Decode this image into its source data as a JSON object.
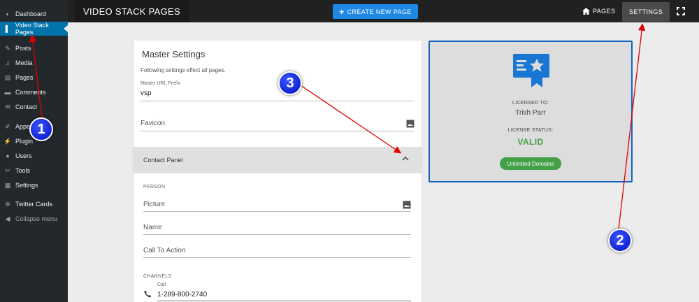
{
  "wp_sidebar": {
    "items": [
      {
        "label": "Dashboard",
        "icon": "dashboard-icon"
      },
      {
        "label": "Video Stack Pages",
        "icon": "pin-icon",
        "active": true
      },
      {
        "label": "Posts",
        "icon": "pin-icon"
      },
      {
        "label": "Media",
        "icon": "media-icon"
      },
      {
        "label": "Pages",
        "icon": "pages-icon"
      },
      {
        "label": "Comments",
        "icon": "comment-icon"
      },
      {
        "label": "Contact",
        "icon": "mail-icon"
      },
      {
        "label": "Appe",
        "icon": "brush-icon"
      },
      {
        "label": "Plugin",
        "icon": "plugin-icon"
      },
      {
        "label": "Users",
        "icon": "user-icon"
      },
      {
        "label": "Tools",
        "icon": "wrench-icon"
      },
      {
        "label": "Settings",
        "icon": "settings-icon"
      },
      {
        "label": "Twitter Cards",
        "icon": "gear-icon"
      },
      {
        "label": "Collapse menu",
        "icon": "collapse-icon"
      }
    ]
  },
  "topbar": {
    "title": "VIDEO STACK PAGES",
    "create_label": "CREATE NEW PAGE",
    "pages_label": "PAGES",
    "settings_label": "SETTINGS"
  },
  "master": {
    "title": "Master Settings",
    "subtitle": "Following settings effect all pages.",
    "url_prefix_label": "Master URL Prefix",
    "url_prefix_value": "vsp",
    "favicon_placeholder": "Favicon"
  },
  "contact": {
    "panel_title": "Contact Panel",
    "person_label": "PERSON",
    "picture_placeholder": "Picture",
    "name_placeholder": "Name",
    "cta_placeholder": "Call To Action",
    "channels_label": "CHANNELS",
    "call_label": "Call",
    "call_value": "1-289-800-2740"
  },
  "license": {
    "licensed_to_label": "LICENSED TO:",
    "licensed_to_value": "Trish Parr",
    "status_label": "LICENSE STATUS:",
    "status_value": "VALID",
    "tag": "Unlimited Domains"
  },
  "annotations": [
    "1",
    "2",
    "3"
  ],
  "colors": {
    "accent": "#1e88e5",
    "valid": "#43a047",
    "wp_sidebar": "#23282d",
    "wp_active": "#0073aa",
    "annotation": "#e00000"
  }
}
